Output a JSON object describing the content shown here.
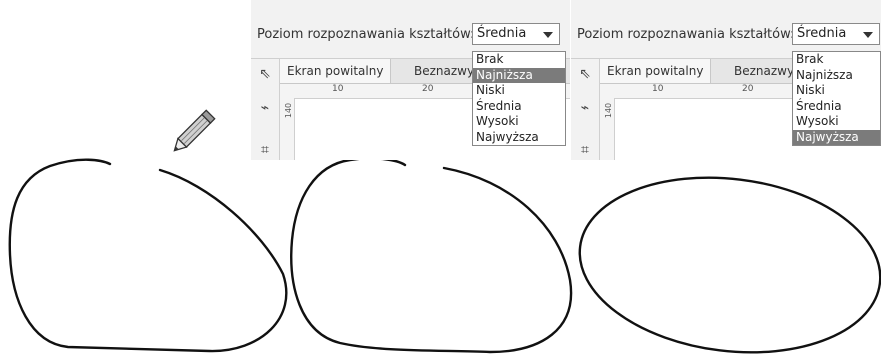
{
  "panels": [
    {
      "label": "Poziom rozpoznawania kształtów:",
      "combo_value": "Średnia",
      "tabs": [
        "Ekran powitalny",
        "Beznazwy"
      ],
      "ruler": [
        "10",
        "20"
      ],
      "vruler": "140",
      "options": [
        "Brak",
        "Najniższa",
        "Niski",
        "Średnia",
        "Wysoki",
        "Najwyższa"
      ],
      "highlighted": "Najniższa"
    },
    {
      "label": "Poziom rozpoznawania kształtów:",
      "combo_value": "Średnia",
      "tabs": [
        "Ekran powitalny",
        "Beznazwy"
      ],
      "ruler": [
        "10",
        "20"
      ],
      "vruler": "140",
      "options": [
        "Brak",
        "Najniższa",
        "Niski",
        "Średnia",
        "Wysoki",
        "Najwyższa"
      ],
      "highlighted": "Najwyższa"
    }
  ],
  "icons": {
    "tools": [
      "pick-tool-icon",
      "shape-tool-icon",
      "crop-tool-icon"
    ],
    "pencil": "pencil-icon"
  }
}
